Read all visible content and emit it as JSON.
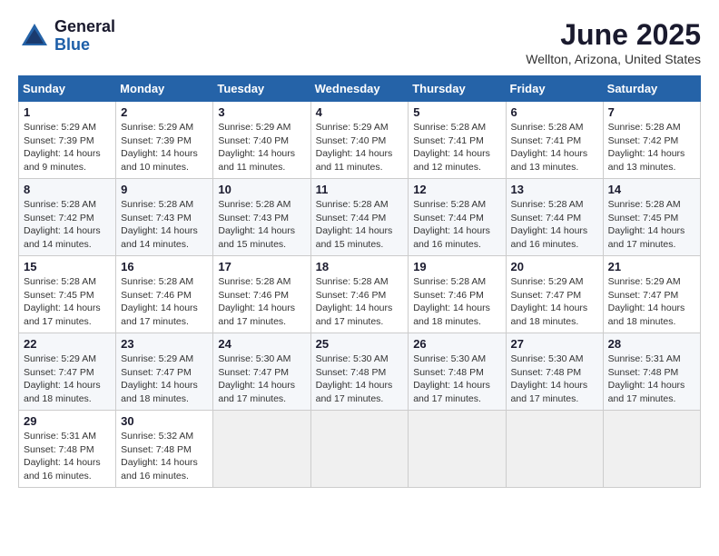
{
  "header": {
    "logo": {
      "general": "General",
      "blue": "Blue"
    },
    "title": "June 2025",
    "location": "Wellton, Arizona, United States"
  },
  "calendar": {
    "days_of_week": [
      "Sunday",
      "Monday",
      "Tuesday",
      "Wednesday",
      "Thursday",
      "Friday",
      "Saturday"
    ],
    "weeks": [
      [
        {
          "day": "1",
          "sunrise": "Sunrise: 5:29 AM",
          "sunset": "Sunset: 7:39 PM",
          "daylight": "Daylight: 14 hours and 9 minutes."
        },
        {
          "day": "2",
          "sunrise": "Sunrise: 5:29 AM",
          "sunset": "Sunset: 7:39 PM",
          "daylight": "Daylight: 14 hours and 10 minutes."
        },
        {
          "day": "3",
          "sunrise": "Sunrise: 5:29 AM",
          "sunset": "Sunset: 7:40 PM",
          "daylight": "Daylight: 14 hours and 11 minutes."
        },
        {
          "day": "4",
          "sunrise": "Sunrise: 5:29 AM",
          "sunset": "Sunset: 7:40 PM",
          "daylight": "Daylight: 14 hours and 11 minutes."
        },
        {
          "day": "5",
          "sunrise": "Sunrise: 5:28 AM",
          "sunset": "Sunset: 7:41 PM",
          "daylight": "Daylight: 14 hours and 12 minutes."
        },
        {
          "day": "6",
          "sunrise": "Sunrise: 5:28 AM",
          "sunset": "Sunset: 7:41 PM",
          "daylight": "Daylight: 14 hours and 13 minutes."
        },
        {
          "day": "7",
          "sunrise": "Sunrise: 5:28 AM",
          "sunset": "Sunset: 7:42 PM",
          "daylight": "Daylight: 14 hours and 13 minutes."
        }
      ],
      [
        {
          "day": "8",
          "sunrise": "Sunrise: 5:28 AM",
          "sunset": "Sunset: 7:42 PM",
          "daylight": "Daylight: 14 hours and 14 minutes."
        },
        {
          "day": "9",
          "sunrise": "Sunrise: 5:28 AM",
          "sunset": "Sunset: 7:43 PM",
          "daylight": "Daylight: 14 hours and 14 minutes."
        },
        {
          "day": "10",
          "sunrise": "Sunrise: 5:28 AM",
          "sunset": "Sunset: 7:43 PM",
          "daylight": "Daylight: 14 hours and 15 minutes."
        },
        {
          "day": "11",
          "sunrise": "Sunrise: 5:28 AM",
          "sunset": "Sunset: 7:44 PM",
          "daylight": "Daylight: 14 hours and 15 minutes."
        },
        {
          "day": "12",
          "sunrise": "Sunrise: 5:28 AM",
          "sunset": "Sunset: 7:44 PM",
          "daylight": "Daylight: 14 hours and 16 minutes."
        },
        {
          "day": "13",
          "sunrise": "Sunrise: 5:28 AM",
          "sunset": "Sunset: 7:44 PM",
          "daylight": "Daylight: 14 hours and 16 minutes."
        },
        {
          "day": "14",
          "sunrise": "Sunrise: 5:28 AM",
          "sunset": "Sunset: 7:45 PM",
          "daylight": "Daylight: 14 hours and 17 minutes."
        }
      ],
      [
        {
          "day": "15",
          "sunrise": "Sunrise: 5:28 AM",
          "sunset": "Sunset: 7:45 PM",
          "daylight": "Daylight: 14 hours and 17 minutes."
        },
        {
          "day": "16",
          "sunrise": "Sunrise: 5:28 AM",
          "sunset": "Sunset: 7:46 PM",
          "daylight": "Daylight: 14 hours and 17 minutes."
        },
        {
          "day": "17",
          "sunrise": "Sunrise: 5:28 AM",
          "sunset": "Sunset: 7:46 PM",
          "daylight": "Daylight: 14 hours and 17 minutes."
        },
        {
          "day": "18",
          "sunrise": "Sunrise: 5:28 AM",
          "sunset": "Sunset: 7:46 PM",
          "daylight": "Daylight: 14 hours and 17 minutes."
        },
        {
          "day": "19",
          "sunrise": "Sunrise: 5:28 AM",
          "sunset": "Sunset: 7:46 PM",
          "daylight": "Daylight: 14 hours and 18 minutes."
        },
        {
          "day": "20",
          "sunrise": "Sunrise: 5:29 AM",
          "sunset": "Sunset: 7:47 PM",
          "daylight": "Daylight: 14 hours and 18 minutes."
        },
        {
          "day": "21",
          "sunrise": "Sunrise: 5:29 AM",
          "sunset": "Sunset: 7:47 PM",
          "daylight": "Daylight: 14 hours and 18 minutes."
        }
      ],
      [
        {
          "day": "22",
          "sunrise": "Sunrise: 5:29 AM",
          "sunset": "Sunset: 7:47 PM",
          "daylight": "Daylight: 14 hours and 18 minutes."
        },
        {
          "day": "23",
          "sunrise": "Sunrise: 5:29 AM",
          "sunset": "Sunset: 7:47 PM",
          "daylight": "Daylight: 14 hours and 18 minutes."
        },
        {
          "day": "24",
          "sunrise": "Sunrise: 5:30 AM",
          "sunset": "Sunset: 7:47 PM",
          "daylight": "Daylight: 14 hours and 17 minutes."
        },
        {
          "day": "25",
          "sunrise": "Sunrise: 5:30 AM",
          "sunset": "Sunset: 7:48 PM",
          "daylight": "Daylight: 14 hours and 17 minutes."
        },
        {
          "day": "26",
          "sunrise": "Sunrise: 5:30 AM",
          "sunset": "Sunset: 7:48 PM",
          "daylight": "Daylight: 14 hours and 17 minutes."
        },
        {
          "day": "27",
          "sunrise": "Sunrise: 5:30 AM",
          "sunset": "Sunset: 7:48 PM",
          "daylight": "Daylight: 14 hours and 17 minutes."
        },
        {
          "day": "28",
          "sunrise": "Sunrise: 5:31 AM",
          "sunset": "Sunset: 7:48 PM",
          "daylight": "Daylight: 14 hours and 17 minutes."
        }
      ],
      [
        {
          "day": "29",
          "sunrise": "Sunrise: 5:31 AM",
          "sunset": "Sunset: 7:48 PM",
          "daylight": "Daylight: 14 hours and 16 minutes."
        },
        {
          "day": "30",
          "sunrise": "Sunrise: 5:32 AM",
          "sunset": "Sunset: 7:48 PM",
          "daylight": "Daylight: 14 hours and 16 minutes."
        },
        null,
        null,
        null,
        null,
        null
      ]
    ]
  }
}
